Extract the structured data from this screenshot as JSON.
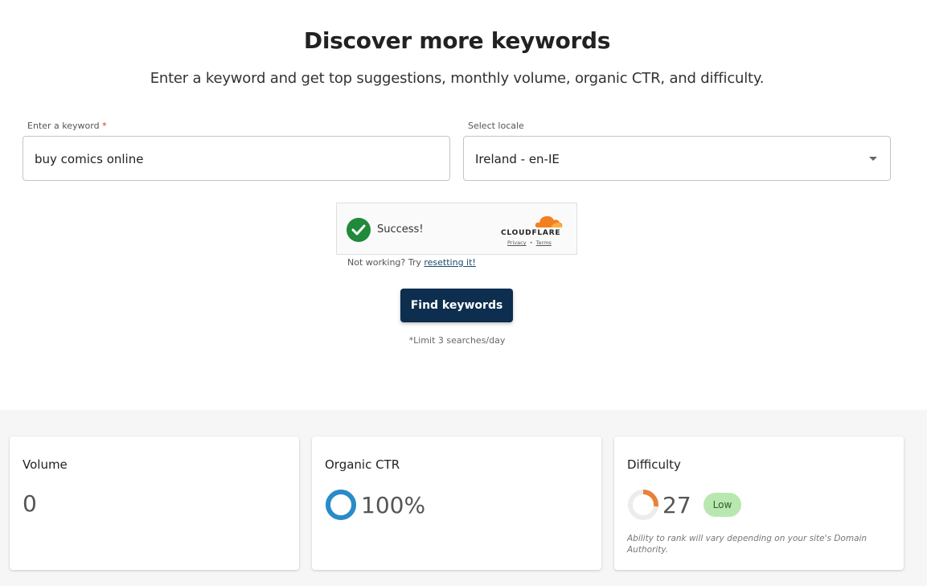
{
  "header": {
    "title": "Discover more keywords",
    "subtitle": "Enter a keyword and get top suggestions, monthly volume, organic CTR, and difficulty."
  },
  "form": {
    "keyword_label": "Enter a keyword",
    "required_marker": "*",
    "keyword_value": "buy comics online",
    "locale_label": "Select locale",
    "locale_value": "Ireland - en-IE"
  },
  "captcha": {
    "status": "Success!",
    "brand": "CLOUDFLARE",
    "privacy_link": "Privacy",
    "separator": "•",
    "terms_link": "Terms",
    "retry_text": "Not working? Try ",
    "retry_link": "resetting it!"
  },
  "actions": {
    "find_label": "Find keywords",
    "limit_note": "*Limit 3 searches/day"
  },
  "results": {
    "volume": {
      "title": "Volume",
      "value": "0"
    },
    "ctr": {
      "title": "Organic CTR",
      "value": "100%",
      "fraction": 1.0
    },
    "difficulty": {
      "title": "Difficulty",
      "value": "27",
      "fraction": 0.27,
      "badge": "Low",
      "note": "Ability to rank will vary depending on your site's Domain Authority."
    }
  },
  "colors": {
    "primary_button": "#0d2e4e",
    "ctr_ring": "#2a8bc9",
    "difficulty_ring": "#e8823a",
    "badge_bg": "#b8e8b0",
    "success_check": "#1f8a3a",
    "cloudflare_orange": "#f38020"
  },
  "icons": {
    "success": "checkmark-icon",
    "locale_dropdown": "chevron-down-icon",
    "brand": "cloudflare-cloud-icon"
  }
}
